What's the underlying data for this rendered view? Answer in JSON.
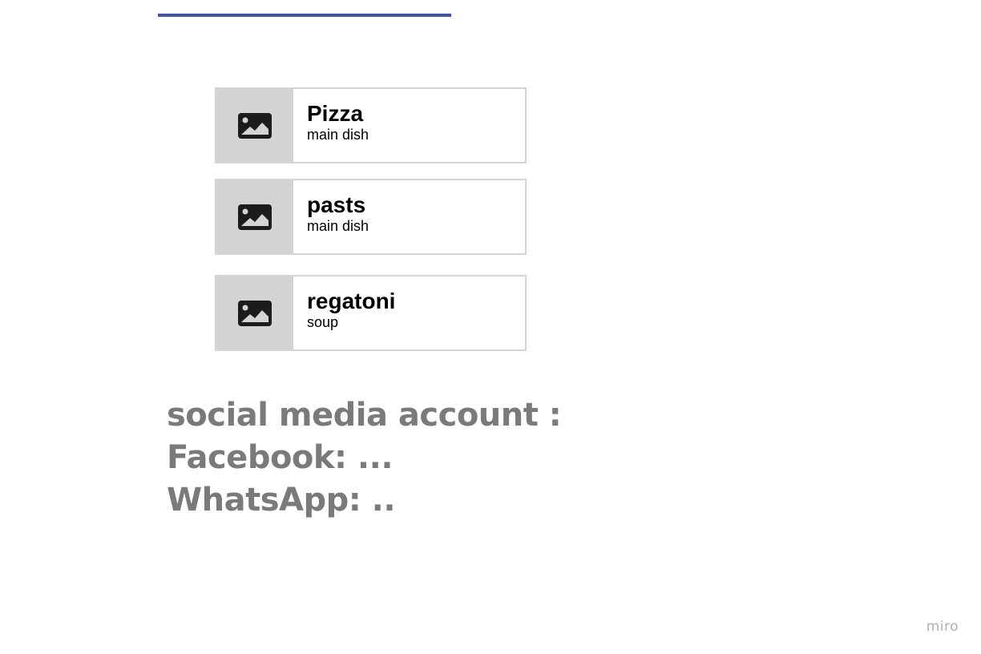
{
  "menu": {
    "items": [
      {
        "name": "Pizza",
        "category": "main dish",
        "icon": "image-icon"
      },
      {
        "name": "pasts",
        "category": "main dish",
        "icon": "image-icon"
      },
      {
        "name": "regatoni",
        "category": "soup",
        "icon": "image-icon"
      }
    ]
  },
  "social": {
    "heading": "social media account :",
    "facebook": "Facebook: ...",
    "whatsapp": "WhatsApp: .."
  },
  "watermark": "miro",
  "colors": {
    "accent_line": "#3f51b5",
    "card_border": "#d4d4d4",
    "social_text": "#7a7a7a"
  }
}
